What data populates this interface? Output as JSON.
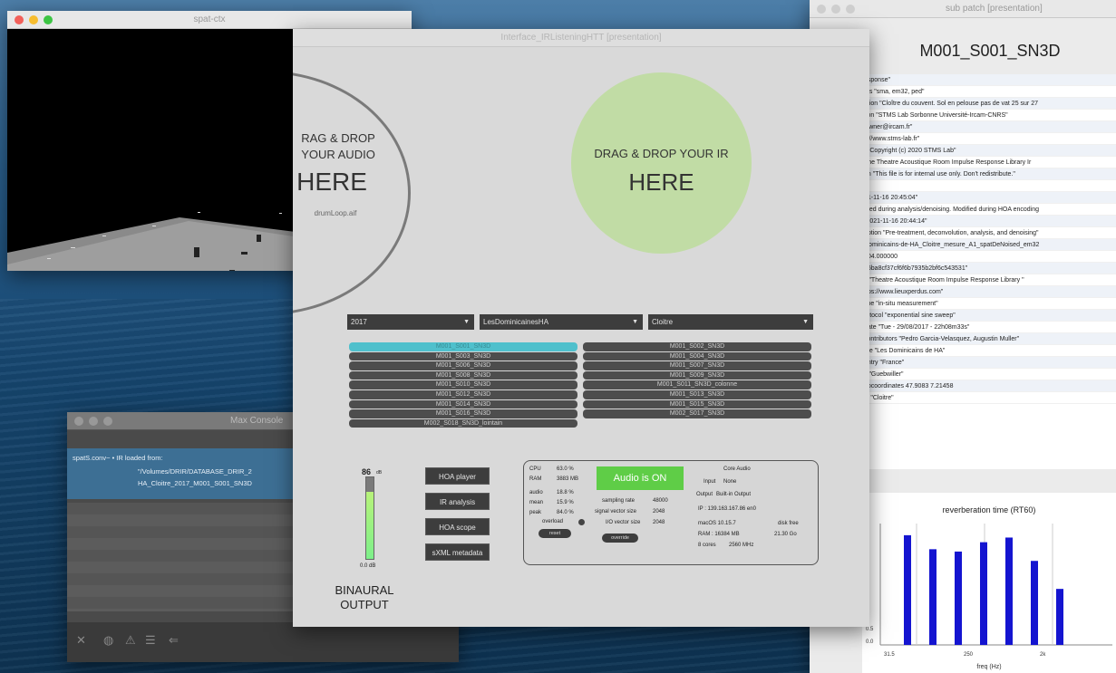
{
  "spat_window": {
    "title": "spat-ctx"
  },
  "main_window": {
    "title": "Interface_IRListeningHTT [presentation]",
    "drop_audio": {
      "line1": "RAG & DROP",
      "line2": "YOUR AUDIO",
      "line3": "HERE",
      "file": "drumLoop.aif"
    },
    "drop_ir": {
      "line1": "DRAG & DROP YOUR IR",
      "line2": "HERE"
    },
    "dropdowns": {
      "year": "2017",
      "place": "LesDominicainesHA",
      "room": "Cloitre"
    },
    "ir_list": {
      "left": [
        "M001_S001_SN3D",
        "M001_S003_SN3D",
        "M001_S006_SN3D",
        "M001_S008_SN3D",
        "M001_S010_SN3D",
        "M001_S012_SN3D",
        "M001_S014_SN3D",
        "M001_S016_SN3D",
        "M002_S018_SN3D_lointain"
      ],
      "right": [
        "M001_S002_SN3D",
        "M001_S004_SN3D",
        "M001_S007_SN3D",
        "M001_S009_SN3D",
        "M001_S011_SN3D_colonne",
        "M001_S013_SN3D",
        "M001_S015_SN3D",
        "M002_S017_SN3D"
      ]
    },
    "buttons": {
      "hoa_player": "HOA player",
      "ir_analysis": "IR analysis",
      "hoa_scope": "HOA scope",
      "sofa_metadata": "sXML metadata"
    },
    "meter": {
      "top": "86",
      "top_unit": "dB",
      "bottom": "0.0 dB",
      "level": 0.82
    },
    "binaural": {
      "line1": "BINAURAL",
      "line2": "OUTPUT"
    },
    "status": {
      "cpu_label": "CPU",
      "cpu_value": "63.0 %",
      "ram_label": "RAM",
      "ram_value": "3883 MB",
      "audio_label": "audio",
      "audio_value": "18.8 %",
      "mean_label": "mean",
      "mean_value": "15.9 %",
      "peak_label": "peak",
      "peak_value": "84.0 %",
      "overload_label": "overload",
      "reset_label": "reset",
      "audio_on": "Audio is ON",
      "sampling_rate_label": "sampling rate",
      "sampling_rate": "48000",
      "signal_vector_label": "signal vector size",
      "signal_vector": "2048",
      "io_vector_label": "I/O vector size",
      "io_vector": "2048",
      "override_label": "override",
      "driver": "Core Audio",
      "input_label": "Input",
      "input_value": "None",
      "output_label": "Output",
      "output_value": "Built-in Output",
      "ip": "IP : 139.163.167.86  en0",
      "os": "macOS 10.15.7",
      "disk_label": "disk free",
      "disk": "21.30 Go",
      "ram_total": "RAM : 16384 MB",
      "cores": "8 cores",
      "freq": "2560 MHz"
    }
  },
  "console_window": {
    "title": "Max Console",
    "message_source": "spatS.conv~ • IR loaded from:",
    "message_path1": "\"/Volumes/DRIR/DATABASE_DRIR_2",
    "message_path2": "HA_Cloitre_2017_M001_S001_SN3D"
  },
  "right_window": {
    "window_title": "sub patch [presentation]",
    "heading": "M001_S001_SN3D",
    "metadata": [
      "esponse\"",
      "nts \"sma, em32, ped\"",
      "otion \"Cloître du couvent. Sol en pelouse pas de vat 25 sur 27",
      "tion \"STMS Lab Sorbonne Université-Ircam-CNRS\"",
      "'owner@ircam.fr\"",
      "c://www.stms-lab.fr\"",
      "t \"Copyright (c) 2020 STMS Lab\"",
      "The  Theatre Acoustique Room Impulse Response Library  Ir",
      "on \"This file is for internal use only. Don't redistribute.\"",
      "",
      "21-11-16 20:45:04\"",
      "ated during analysis/denoising. Modified during HOA encoding",
      "\"2021-11-16 20:44:14\"",
      "ription \"Pre-treatment, deconvolution, analysis, and denoising\"",
      "Dominicains-de-HA_Cloitre_mesure_A1_spatDeNoised_em32",
      "104.000000",
      "06ba8cf37cf6f6b7935b2bf6c543531\"",
      "s \"Theatre  Acoustique  Room  Impulse  Response  Library  \"",
      "ttps://www.lieuxperdus.com\"",
      "ype \"in-situ measurement\"",
      "rotocol \"exponential sine sweep\"",
      "date \"Tue - 29/08/2017 - 22h08m33s\"",
      "contributors \"Pedro  Garcia-Velasquez,  Augustin  Muller\"",
      "me \"Les Dominicains de HA\"",
      "untry \"France\"",
      "y \"Guebwiller\"",
      "eocoordinates 47.9083 7.21458",
      "ie \"Cloitre\""
    ]
  },
  "chart_data": {
    "type": "bar",
    "title": "reverberation time (RT60)",
    "xlabel": "freq (Hz)",
    "ylabel": "",
    "x_ticks": [
      "31.5",
      "250",
      "2k"
    ],
    "y_ticks": [
      "0.5",
      "0.0"
    ],
    "values": [
      2.35,
      2.05,
      2.0,
      2.2,
      2.3,
      1.8,
      1.2
    ],
    "ylim": [
      0,
      2.6
    ],
    "bar_color": "#1414d0"
  }
}
